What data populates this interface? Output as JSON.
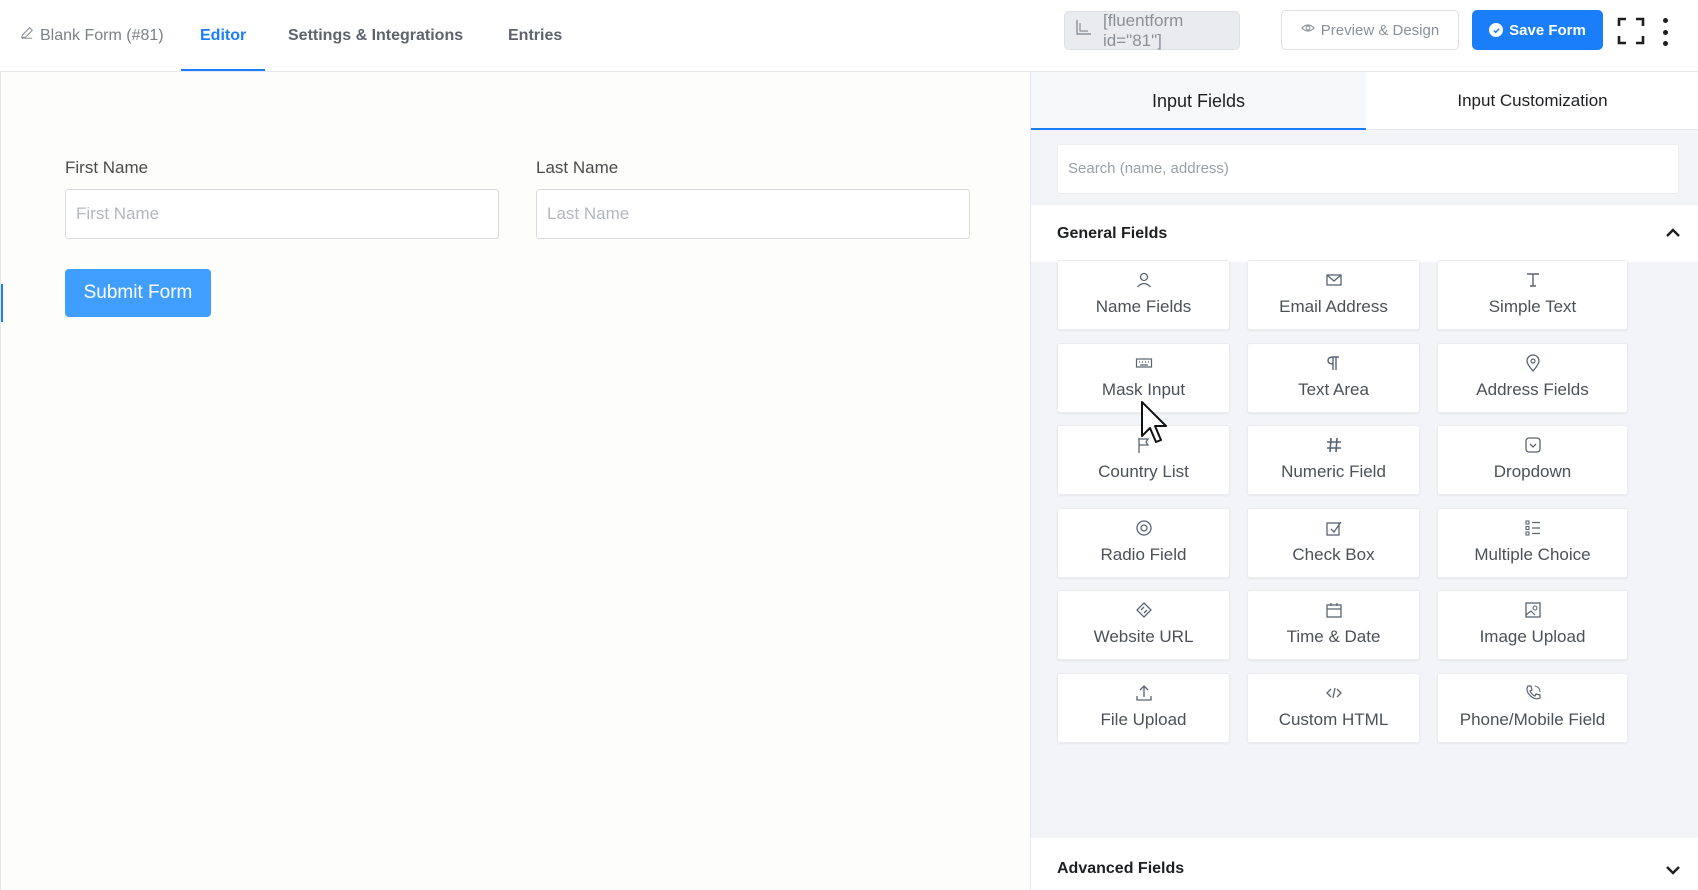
{
  "header": {
    "form_title": "Blank Form (#81)",
    "tabs": [
      "Editor",
      "Settings & Integrations",
      "Entries"
    ],
    "active_tab": "Editor",
    "shortcode": "[fluentform id=\"81\"]",
    "preview_label": "Preview & Design",
    "save_label": "Save Form"
  },
  "form": {
    "first_name_label": "First Name",
    "first_name_placeholder": "First Name",
    "last_name_label": "Last Name",
    "last_name_placeholder": "Last Name",
    "submit_label": "Submit Form"
  },
  "panel": {
    "tabs": [
      "Input Fields",
      "Input Customization"
    ],
    "active_tab": "Input Fields",
    "search_placeholder": "Search (name, address)",
    "general_title": "General Fields",
    "advanced_title": "Advanced Fields",
    "fields": [
      {
        "label": "Name Fields",
        "icon": "user-icon"
      },
      {
        "label": "Email Address",
        "icon": "envelope-icon"
      },
      {
        "label": "Simple Text",
        "icon": "text-icon"
      },
      {
        "label": "Mask Input",
        "icon": "keyboard-icon"
      },
      {
        "label": "Text Area",
        "icon": "paragraph-icon"
      },
      {
        "label": "Address Fields",
        "icon": "map-pin-icon"
      },
      {
        "label": "Country List",
        "icon": "flag-icon"
      },
      {
        "label": "Numeric Field",
        "icon": "hash-icon"
      },
      {
        "label": "Dropdown",
        "icon": "dropdown-icon"
      },
      {
        "label": "Radio Field",
        "icon": "radio-icon"
      },
      {
        "label": "Check Box",
        "icon": "checkbox-icon"
      },
      {
        "label": "Multiple Choice",
        "icon": "list-icon"
      },
      {
        "label": "Website URL",
        "icon": "link-icon"
      },
      {
        "label": "Time & Date",
        "icon": "calendar-icon"
      },
      {
        "label": "Image Upload",
        "icon": "image-icon"
      },
      {
        "label": "File Upload",
        "icon": "upload-icon"
      },
      {
        "label": "Custom HTML",
        "icon": "code-icon"
      },
      {
        "label": "Phone/Mobile Field",
        "icon": "phone-icon"
      }
    ]
  },
  "colors": {
    "accent": "#1a7efb",
    "submit": "#409eff"
  }
}
